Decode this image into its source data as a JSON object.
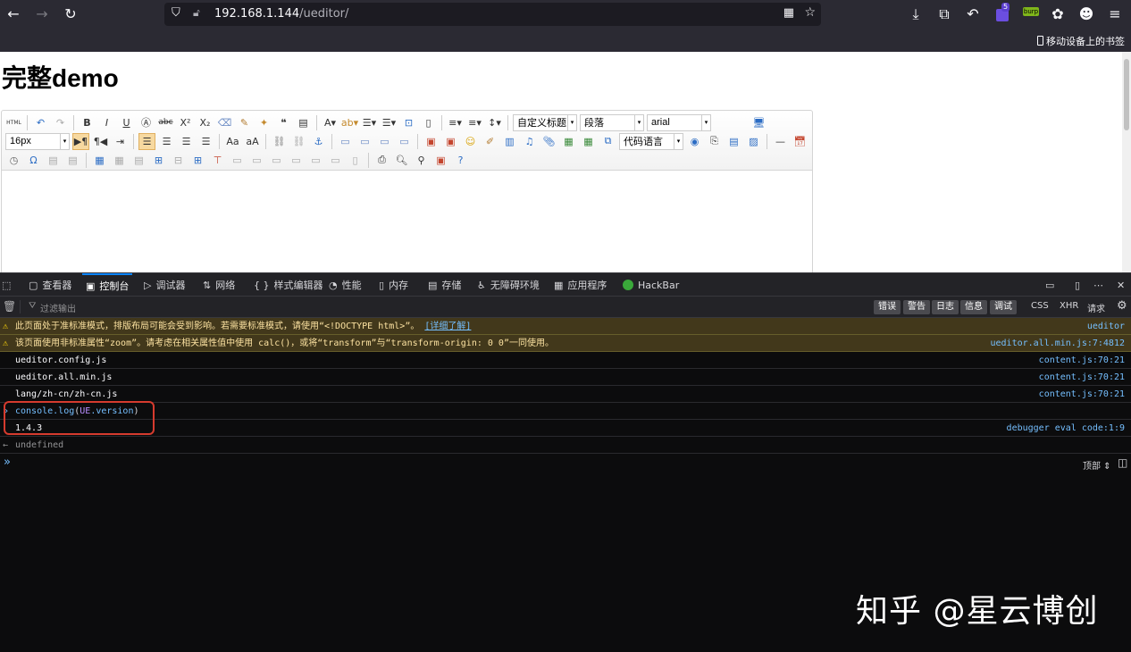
{
  "browser": {
    "url_host": "192.168.1.144",
    "url_path": "/ueditor/",
    "ext_badge": "5",
    "burp_label": "burp",
    "mobile_bookmarks": "移动设备上的书签"
  },
  "page": {
    "title": "完整demo",
    "toolbar": {
      "html_label": "HTML",
      "heading_select": "自定义标题",
      "paragraph_select": "段落",
      "font_select": "arial",
      "size_select": "16px",
      "code_select": "代码语言"
    }
  },
  "devtools": {
    "tabs": [
      "查看器",
      "控制台",
      "调试器",
      "网络",
      "样式编辑器",
      "性能",
      "内存",
      "存储",
      "无障碍环境",
      "应用程序",
      "HackBar"
    ],
    "filter_placeholder": "过滤输出",
    "levels": [
      "错误",
      "警告",
      "日志",
      "信息",
      "调试"
    ],
    "extra_filters": [
      "CSS",
      "XHR",
      "请求"
    ],
    "messages": [
      {
        "type": "warn",
        "text": "此页面处于准标准模式，排版布局可能会受到影响。若需要标准模式，请使用“<!DOCTYPE html>”。",
        "link": "[详细了解]",
        "source": "ueditor"
      },
      {
        "type": "warn",
        "text": "该页面使用非标准属性“zoom”。请考虑在相关属性值中使用 calc()，或将“transform”与“transform-origin: 0 0”一同使用。",
        "source": "ueditor.all.min.js:7:4812"
      },
      {
        "type": "log",
        "text": "ueditor.config.js",
        "source": "content.js:70:21"
      },
      {
        "type": "log",
        "text": "ueditor.all.min.js",
        "source": "content.js:70:21"
      },
      {
        "type": "log",
        "text": "lang/zh-cn/zh-cn.js",
        "source": "content.js:70:21"
      },
      {
        "type": "input",
        "text_prefix": "console.",
        "text_fn": "log",
        "text_arg": "UE",
        "text_prop": ".version",
        "source": ""
      },
      {
        "type": "log",
        "text": "1.4.3",
        "source": "debugger eval code:1:9"
      },
      {
        "type": "result",
        "text": "undefined",
        "source": ""
      }
    ],
    "context": "顶部 ⇕"
  },
  "watermark": "知乎 @星云博创"
}
